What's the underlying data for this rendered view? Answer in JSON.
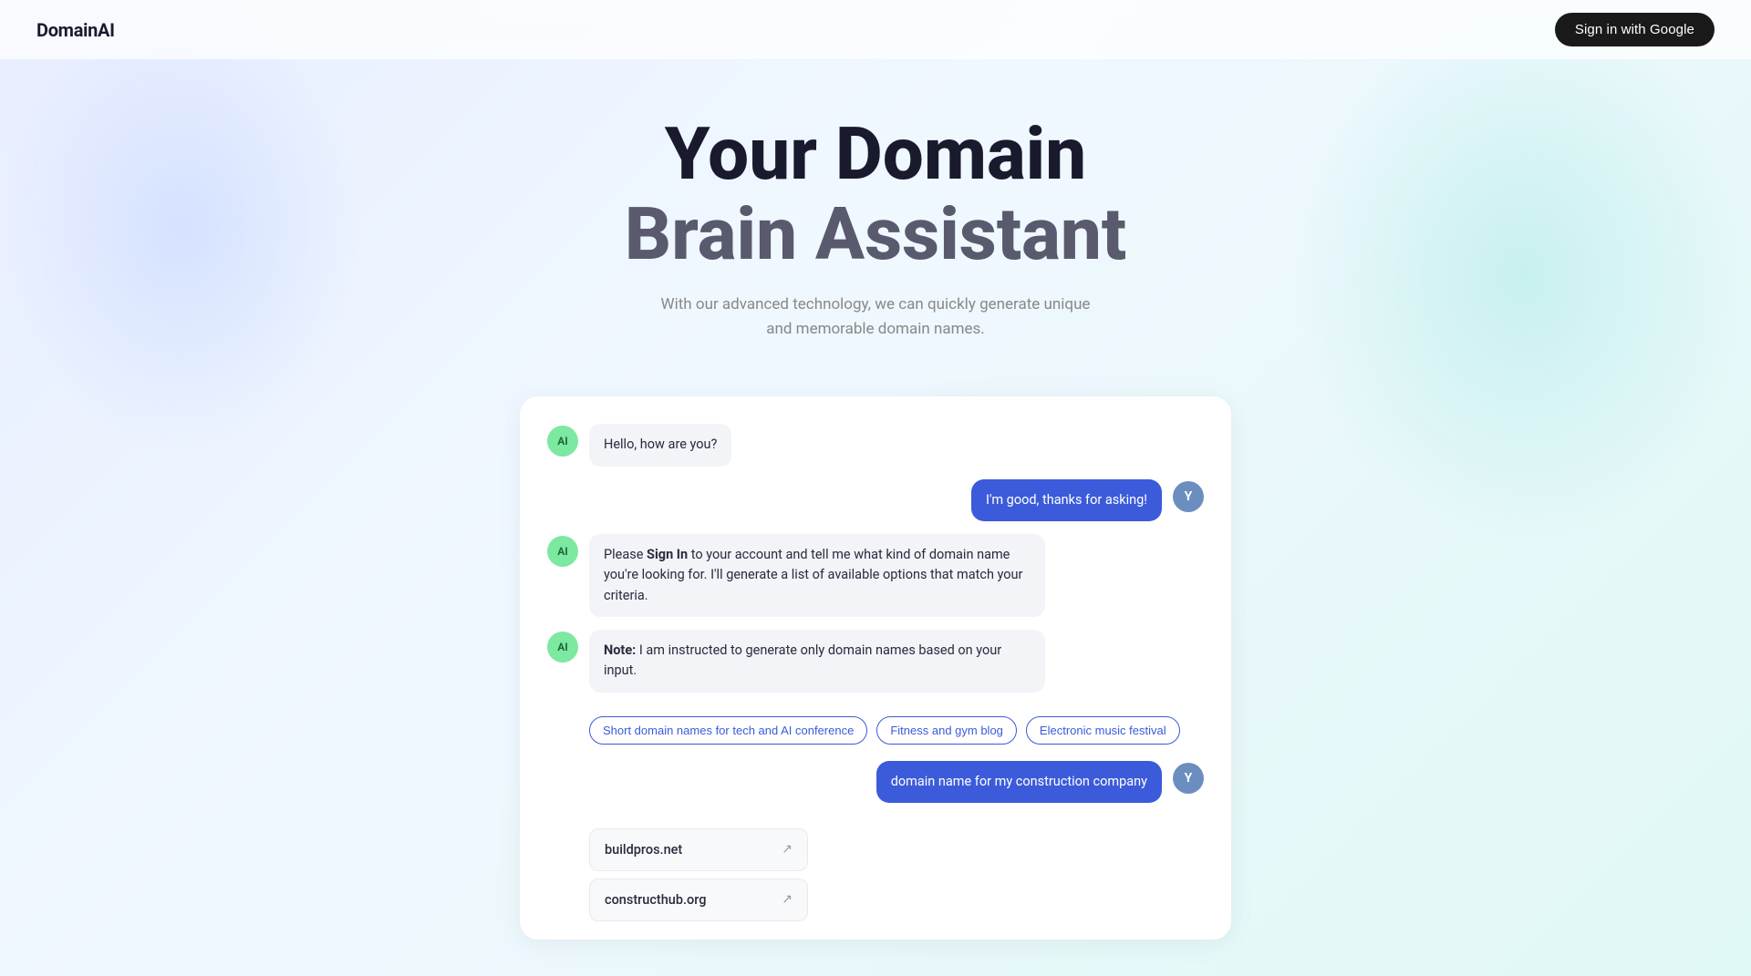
{
  "app": {
    "logo": "DomainAI",
    "sign_in_label": "Sign in with Google"
  },
  "hero": {
    "title_line1": "Your Domain",
    "title_line2": "Brain Assistant",
    "subtitle_line1": "With our advanced technology, we can quickly generate unique",
    "subtitle_line2": "and memorable domain names."
  },
  "chat": {
    "messages": [
      {
        "type": "ai",
        "text": "Hello, how are you?",
        "avatar": "AI"
      },
      {
        "type": "user",
        "text": "I'm good, thanks for asking!",
        "avatar": "Y"
      },
      {
        "type": "ai",
        "html": "Please <b>Sign In</b> to your account and tell me what kind of domain name you're looking for. I'll generate a list of available options that match your criteria.",
        "avatar": "AI"
      },
      {
        "type": "ai",
        "html": "<b>Note:</b> I am instructed to generate only domain names based on your input.",
        "avatar": "AI"
      }
    ],
    "suggestions": [
      "Short domain names for tech and AI conference",
      "Fitness and gym blog",
      "Electronic music festival"
    ],
    "user_message_2": {
      "text": "domain name for my construction company",
      "avatar": "Y"
    },
    "domain_results": [
      {
        "name": "buildpros.net"
      },
      {
        "name": "constructhub.org"
      }
    ]
  },
  "icons": {
    "external_link": "↗"
  }
}
